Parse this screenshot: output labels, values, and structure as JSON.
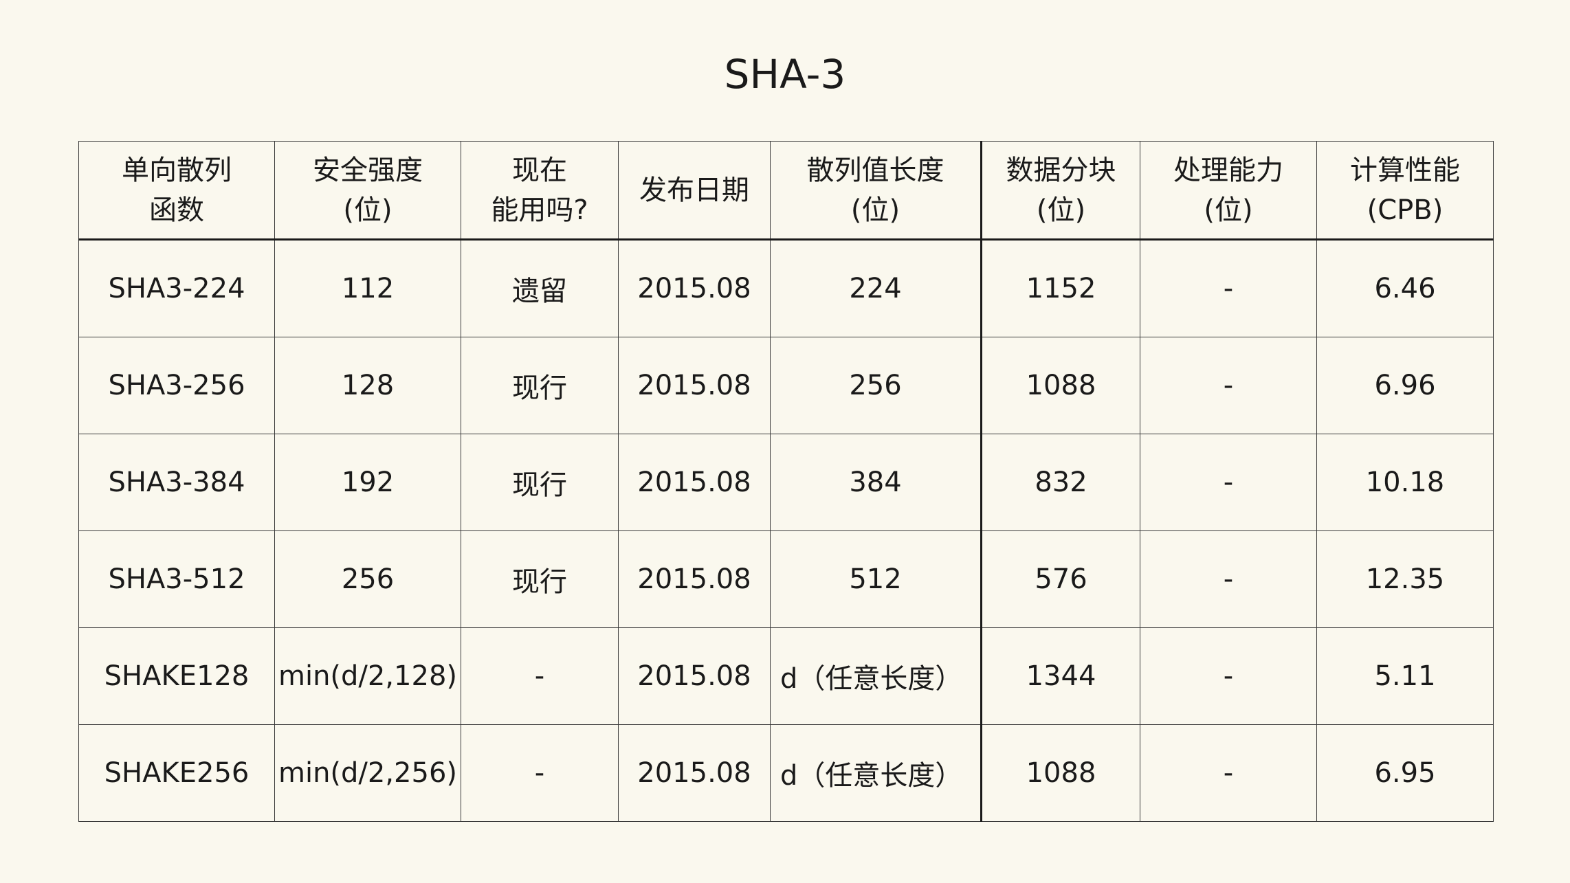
{
  "title": "SHA-3",
  "table": {
    "headers": [
      {
        "line1": "单向散列",
        "line2": "函数"
      },
      {
        "line1": "安全强度",
        "line2": "(位)"
      },
      {
        "line1": "现在",
        "line2": "能用吗?"
      },
      {
        "line1": "发布日期",
        "line2": ""
      },
      {
        "line1": "散列值长度",
        "line2": "(位)"
      },
      {
        "line1": "数据分块",
        "line2": "(位)"
      },
      {
        "line1": "处理能力",
        "line2": "(位)"
      },
      {
        "line1": "计算性能",
        "line2": "(CPB)"
      }
    ],
    "rows": [
      [
        "SHA3-224",
        "112",
        "遗留",
        "2015.08",
        "224",
        "1152",
        "-",
        "6.46"
      ],
      [
        "SHA3-256",
        "128",
        "现行",
        "2015.08",
        "256",
        "1088",
        "-",
        "6.96"
      ],
      [
        "SHA3-384",
        "192",
        "现行",
        "2015.08",
        "384",
        "832",
        "-",
        "10.18"
      ],
      [
        "SHA3-512",
        "256",
        "现行",
        "2015.08",
        "512",
        "576",
        "-",
        "12.35"
      ],
      [
        "SHAKE128",
        "min(d/2,128)",
        "-",
        "2015.08",
        "d（任意长度）",
        "1344",
        "-",
        "5.11"
      ],
      [
        "SHAKE256",
        "min(d/2,256)",
        "-",
        "2015.08",
        "d（任意长度）",
        "1088",
        "-",
        "6.95"
      ]
    ]
  }
}
